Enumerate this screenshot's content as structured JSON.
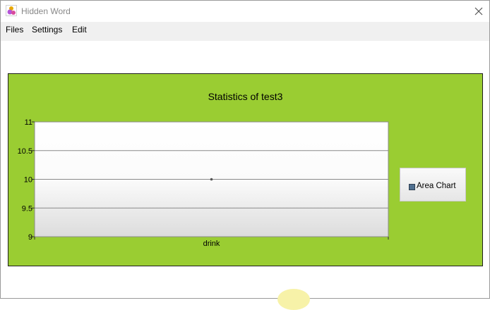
{
  "window": {
    "title": "Hidden Word"
  },
  "menu": {
    "items": [
      "Files",
      "Settings",
      "Edit"
    ]
  },
  "chart_data": {
    "type": "line",
    "title": "Statistics of test3",
    "categories": [
      "drink"
    ],
    "series": [
      {
        "name": "Area Chart",
        "values": [
          10
        ]
      }
    ],
    "ylim": [
      9,
      11
    ],
    "yticks": [
      "11",
      "10.5",
      "10",
      "9.5",
      "9"
    ],
    "grid": true,
    "legend_position": "right"
  },
  "colors": {
    "panel_background": "#9acd32",
    "plot_background": "#ffffff",
    "series_marker": "#555555",
    "legend_swatch": "#4f6f8f"
  }
}
